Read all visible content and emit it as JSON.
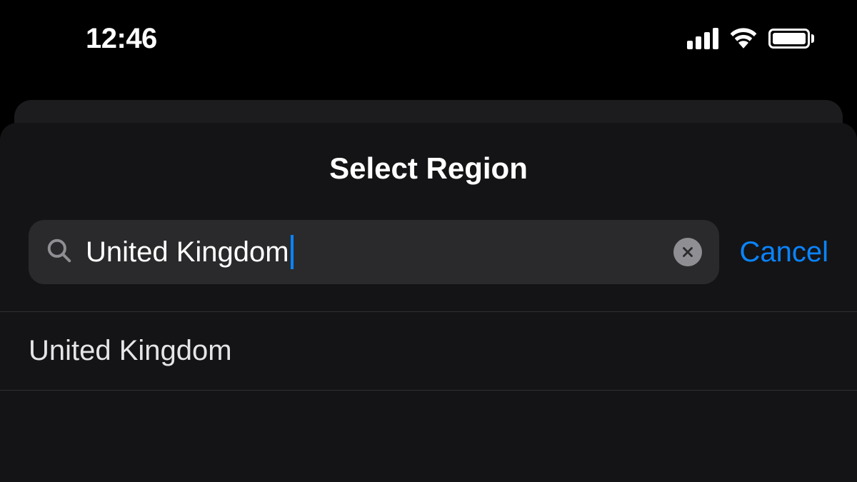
{
  "status_bar": {
    "time": "12:46"
  },
  "modal": {
    "title": "Select Region",
    "search_value": "United Kingdom",
    "cancel_label": "Cancel"
  },
  "results": [
    {
      "label": "United Kingdom"
    }
  ],
  "colors": {
    "accent": "#0a84ff",
    "background": "#000000",
    "modal_bg": "#141416",
    "search_bg": "#2a2a2c"
  }
}
